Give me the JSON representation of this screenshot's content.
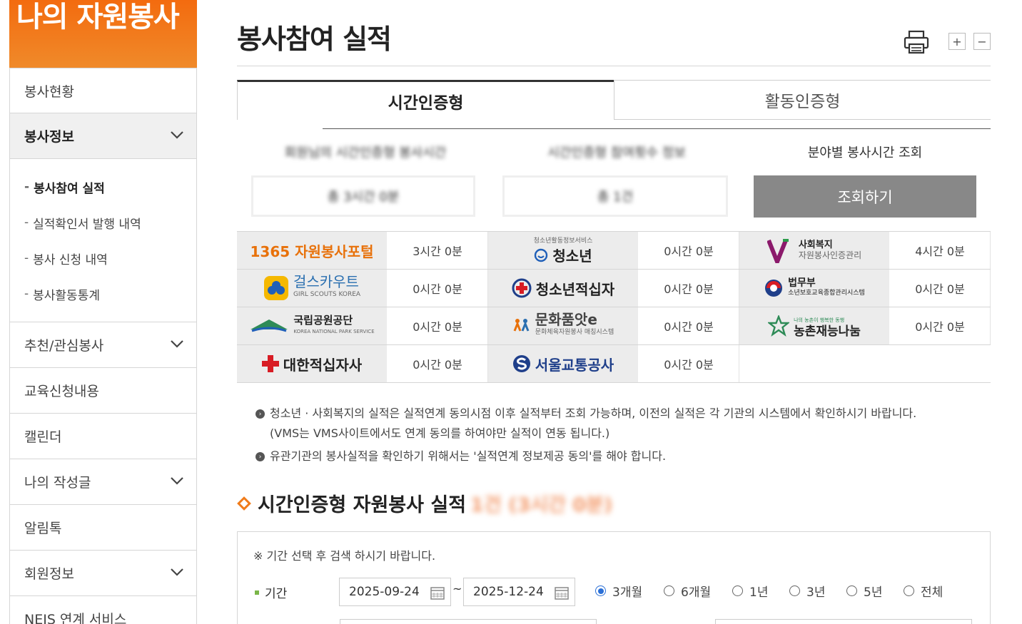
{
  "sidebar": {
    "header": "나의 자원봉사",
    "items": [
      {
        "label": "봉사현황",
        "expandable": false
      },
      {
        "label": "봉사정보",
        "expandable": true
      }
    ],
    "sub_items": [
      "봉사참여 실적",
      "실적확인서 발행 내역",
      "봉사 신청 내역",
      "봉사활동통계"
    ],
    "items_after": [
      {
        "label": "추천/관심봉사",
        "expandable": true
      },
      {
        "label": "교육신청내용",
        "expandable": false
      },
      {
        "label": "캘린더",
        "expandable": false
      },
      {
        "label": "나의 작성글",
        "expandable": true
      },
      {
        "label": "알림톡",
        "expandable": false
      },
      {
        "label": "회원정보",
        "expandable": true
      },
      {
        "label": "NEIS 연계 서비스",
        "expandable": false
      }
    ]
  },
  "page": {
    "title": "봉사참여 실적",
    "zoom_in": "+",
    "zoom_out": "−"
  },
  "tabs": [
    "시간인증형",
    "활동인증형"
  ],
  "summary": {
    "label1": "회원님의 시간인증형 봉사시간",
    "label2": "시간인증형 참여횟수 정보",
    "label3": "분야별 봉사시간 조회",
    "value1": "총 3시간 0분",
    "value2": "총 1건",
    "query_button": "조회하기"
  },
  "orgs": [
    [
      {
        "name": "1365 자원봉사포털",
        "sub": "",
        "value": "3시간 0분"
      },
      {
        "name": "청소년",
        "sub": "청소년활동정보서비스",
        "value": "0시간 0분"
      },
      {
        "name": "사회복지",
        "sub": "자원봉사인증관리",
        "value": "4시간 0분"
      }
    ],
    [
      {
        "name": "걸스카우트",
        "sub": "GIRL SCOUTS KOREA",
        "value": "0시간 0분"
      },
      {
        "name": "청소년적십자",
        "sub": "",
        "value": "0시간 0분"
      },
      {
        "name": "법무부",
        "sub": "소년보호교육종합관리시스템",
        "value": "0시간 0분"
      }
    ],
    [
      {
        "name": "국립공원공단",
        "sub": "KOREA NATIONAL PARK SERVICE",
        "value": "0시간 0분"
      },
      {
        "name": "문화품앗e",
        "sub": "문화체육자원봉사 매칭시스템",
        "value": "0시간 0분"
      },
      {
        "name": "농촌재능나눔",
        "sub": "나의 농촌이 행복한 동행",
        "value": "0시간 0분"
      }
    ],
    [
      {
        "name": "대한적십자사",
        "sub": "",
        "value": "0시간 0분"
      },
      {
        "name": "서울교통공사",
        "sub": "",
        "value": "0시간 0분"
      }
    ]
  ],
  "notes": {
    "note1_line1": "청소년 · 사회복지의 실적은 실적연계 동의시점 이후 실적부터 조회 가능하며, 이전의 실적은 각 기관의 시스템에서 확인하시기 바랍니다.",
    "note1_line2": "(VMS는 VMS사이트에서도 연계 동의를 하여야만 실적이 연동 됩니다.)",
    "note2": "유관기관의 봉사실적을 확인하기 위해서는 '실적연계 정보제공 동의'를 해야 합니다."
  },
  "section": {
    "title": "시간인증형 자원봉사 실적",
    "suffix": "1건 (3시간 0분)"
  },
  "search": {
    "note": "※ 기간 선택 후 검색 하시기 바랍니다.",
    "period_label": "기간",
    "date_from": "2025-09-24",
    "date_to": "2025-12-24",
    "tilde": "~",
    "ranges": [
      "3개월",
      "6개월",
      "1년",
      "3년",
      "5년",
      "전체"
    ],
    "selected_range": "3개월"
  },
  "colors": {
    "accent_orange": "#f36b0f",
    "button_gray": "#888888",
    "radio_blue": "#2a6fd6"
  }
}
